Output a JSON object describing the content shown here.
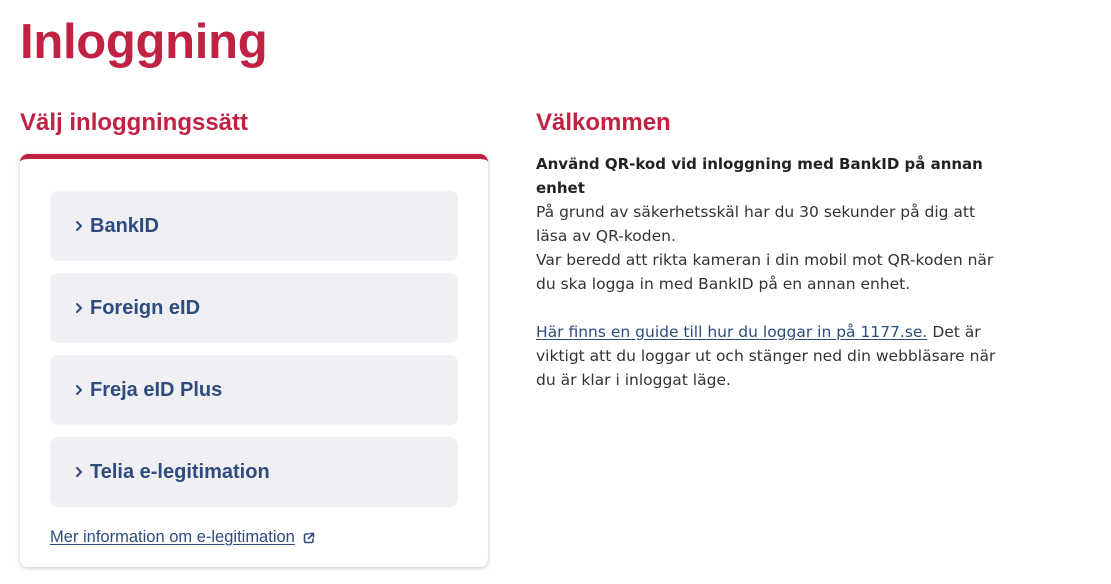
{
  "page": {
    "title": "Inloggning"
  },
  "login": {
    "heading": "Välj inloggningssätt",
    "methods": [
      {
        "label": "BankID"
      },
      {
        "label": "Foreign eID"
      },
      {
        "label": "Freja eID Plus"
      },
      {
        "label": "Telia e-legitimation"
      }
    ],
    "more_info_link": "Mer information om e-legitimation",
    "more_info_icon": "external-link-icon"
  },
  "welcome": {
    "heading": "Välkommen",
    "qr_title": "Använd QR-kod vid inloggning med BankID på annan enhet",
    "qr_line1": "På grund av säkerhetsskäl har du 30 sekunder på dig att läsa av QR-koden.",
    "qr_line2": "Var beredd att rikta kameran i din mobil mot QR-koden när du ska logga in med BankID på en annan enhet.",
    "guide_link": "Här finns en guide till hur du loggar in på 1177.se.",
    "guide_text": " Det är viktigt att du loggar ut och stänger ned din webbläsare när du är klar i inloggat läge."
  },
  "colors": {
    "brand_red": "#c12143",
    "link_blue": "#2d4b7c",
    "item_bg": "#efeff4"
  }
}
